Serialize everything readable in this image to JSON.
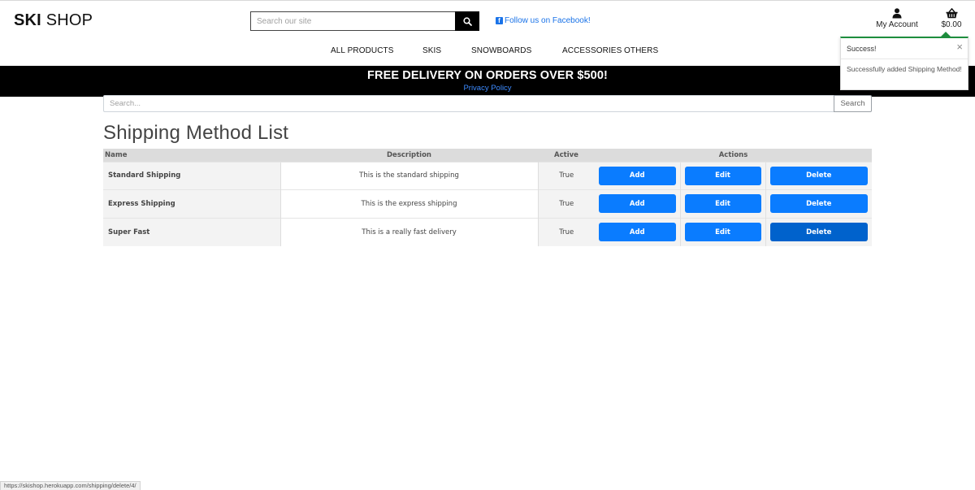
{
  "header": {
    "logo_bold": "SKI",
    "logo_thin": "SHOP",
    "search_placeholder": "Search our site",
    "search_icon": "search-icon",
    "facebook_icon": "facebook-icon",
    "facebook_text": "Follow us on Facebook!",
    "account_icon": "user-icon",
    "account_label": "My Account",
    "basket_icon": "basket-icon",
    "basket_total": "$0.00"
  },
  "nav": {
    "items": [
      "ALL PRODUCTS",
      "SKIS",
      "SNOWBOARDS",
      "ACCESSORIES",
      "OTHERS"
    ]
  },
  "banner": {
    "title": "FREE DELIVERY ON ORDERS OVER $500!",
    "link": "Privacy Policy"
  },
  "page_search": {
    "placeholder": "Search...",
    "button": "Search"
  },
  "page_title": "Shipping Method List",
  "table": {
    "headers": [
      "Name",
      "Description",
      "Active",
      "Actions"
    ],
    "rows": [
      {
        "name": "Standard Shipping",
        "description": "This is the standard shipping",
        "active": "True"
      },
      {
        "name": "Express Shipping",
        "description": "This is the express shipping",
        "active": "True"
      },
      {
        "name": "Super Fast",
        "description": "This is a really fast delivery",
        "active": "True"
      }
    ],
    "action_labels": {
      "add": "Add",
      "edit": "Edit",
      "delete": "Delete"
    }
  },
  "toast": {
    "title": "Success!",
    "close": "×",
    "message": "Successfully added Shipping Method!",
    "accent": "#1e8e3e"
  },
  "status_url": "https://skishop.herokuapp.com/shipping/delete/4/",
  "colors": {
    "primary_button": "#0a7cff",
    "banner_bg": "#000000",
    "link": "#1a73e8"
  }
}
